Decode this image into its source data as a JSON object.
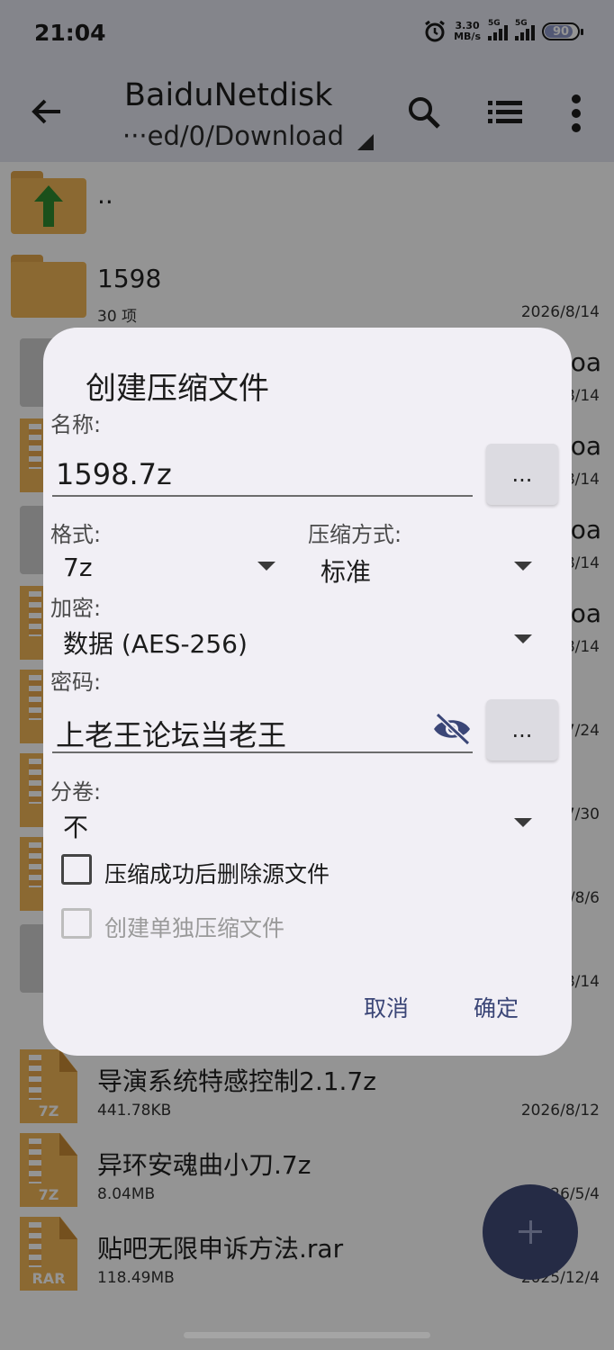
{
  "status_bar": {
    "time": "21:04",
    "speed_value": "3.30",
    "speed_unit": "MB/s",
    "signal1_label": "5G",
    "signal2_label": "5G",
    "battery": "90"
  },
  "app_bar": {
    "title": "BaiduNetdisk",
    "path": "···ed/0/Download"
  },
  "files": [
    {
      "icon": "folder-up",
      "name": "..",
      "meta": "",
      "date": ""
    },
    {
      "icon": "folder",
      "name": "1598",
      "meta": "30 项",
      "date": "2026/8/14"
    },
    {
      "icon": "generic",
      "name": "",
      "right": "loa",
      "date": "8/14"
    },
    {
      "icon": "archive",
      "name": "",
      "right": "oa",
      "date": "8/14"
    },
    {
      "icon": "generic",
      "name": "",
      "right": "oa",
      "date": "8/14"
    },
    {
      "icon": "archive",
      "name": "",
      "right": "oa",
      "date": "8/14"
    },
    {
      "icon": "archive",
      "name": "",
      "right": "",
      "date": "7/24"
    },
    {
      "icon": "archive",
      "name": "",
      "right": "",
      "date": "7/30"
    },
    {
      "icon": "archive",
      "name": "",
      "right": "",
      "date": "/8/6"
    },
    {
      "icon": "generic",
      "name": "",
      "right": "",
      "date": "8/14"
    },
    {
      "icon": "archive",
      "ext": "7Z",
      "name": "导演系统特感控制2.1.7z",
      "meta": "441.78KB",
      "date": "2026/8/12"
    },
    {
      "icon": "archive",
      "ext": "7Z",
      "name": "异环安魂曲小刀.7z",
      "meta": "8.04MB",
      "date": "26/5/4"
    },
    {
      "icon": "archive",
      "ext": "RAR",
      "name": "贴吧无限申诉方法.rar",
      "meta": "118.49MB",
      "date": "2025/12/4"
    }
  ],
  "dialog": {
    "title": "创建压缩文件",
    "name_label": "名称:",
    "name_value": "1598.7z",
    "browse_label": "...",
    "format_label": "格式:",
    "format_value": "7z",
    "method_label": "压缩方式:",
    "method_value": "标准",
    "encrypt_label": "加密:",
    "encrypt_value": "数据 (AES-256)",
    "password_label": "密码:",
    "password_value": "上老王论坛当老王",
    "password_browse_label": "...",
    "split_label": "分卷:",
    "split_value": "不",
    "delete_source_label": "压缩成功后删除源文件",
    "delete_source_checked": false,
    "separate_label": "创建单独压缩文件",
    "separate_enabled": false,
    "cancel_label": "取消",
    "ok_label": "确定"
  },
  "colors": {
    "accent": "#3b4677",
    "fab": "#404b78",
    "dialog_bg": "#f1eff5",
    "folder": "#f0b657"
  }
}
